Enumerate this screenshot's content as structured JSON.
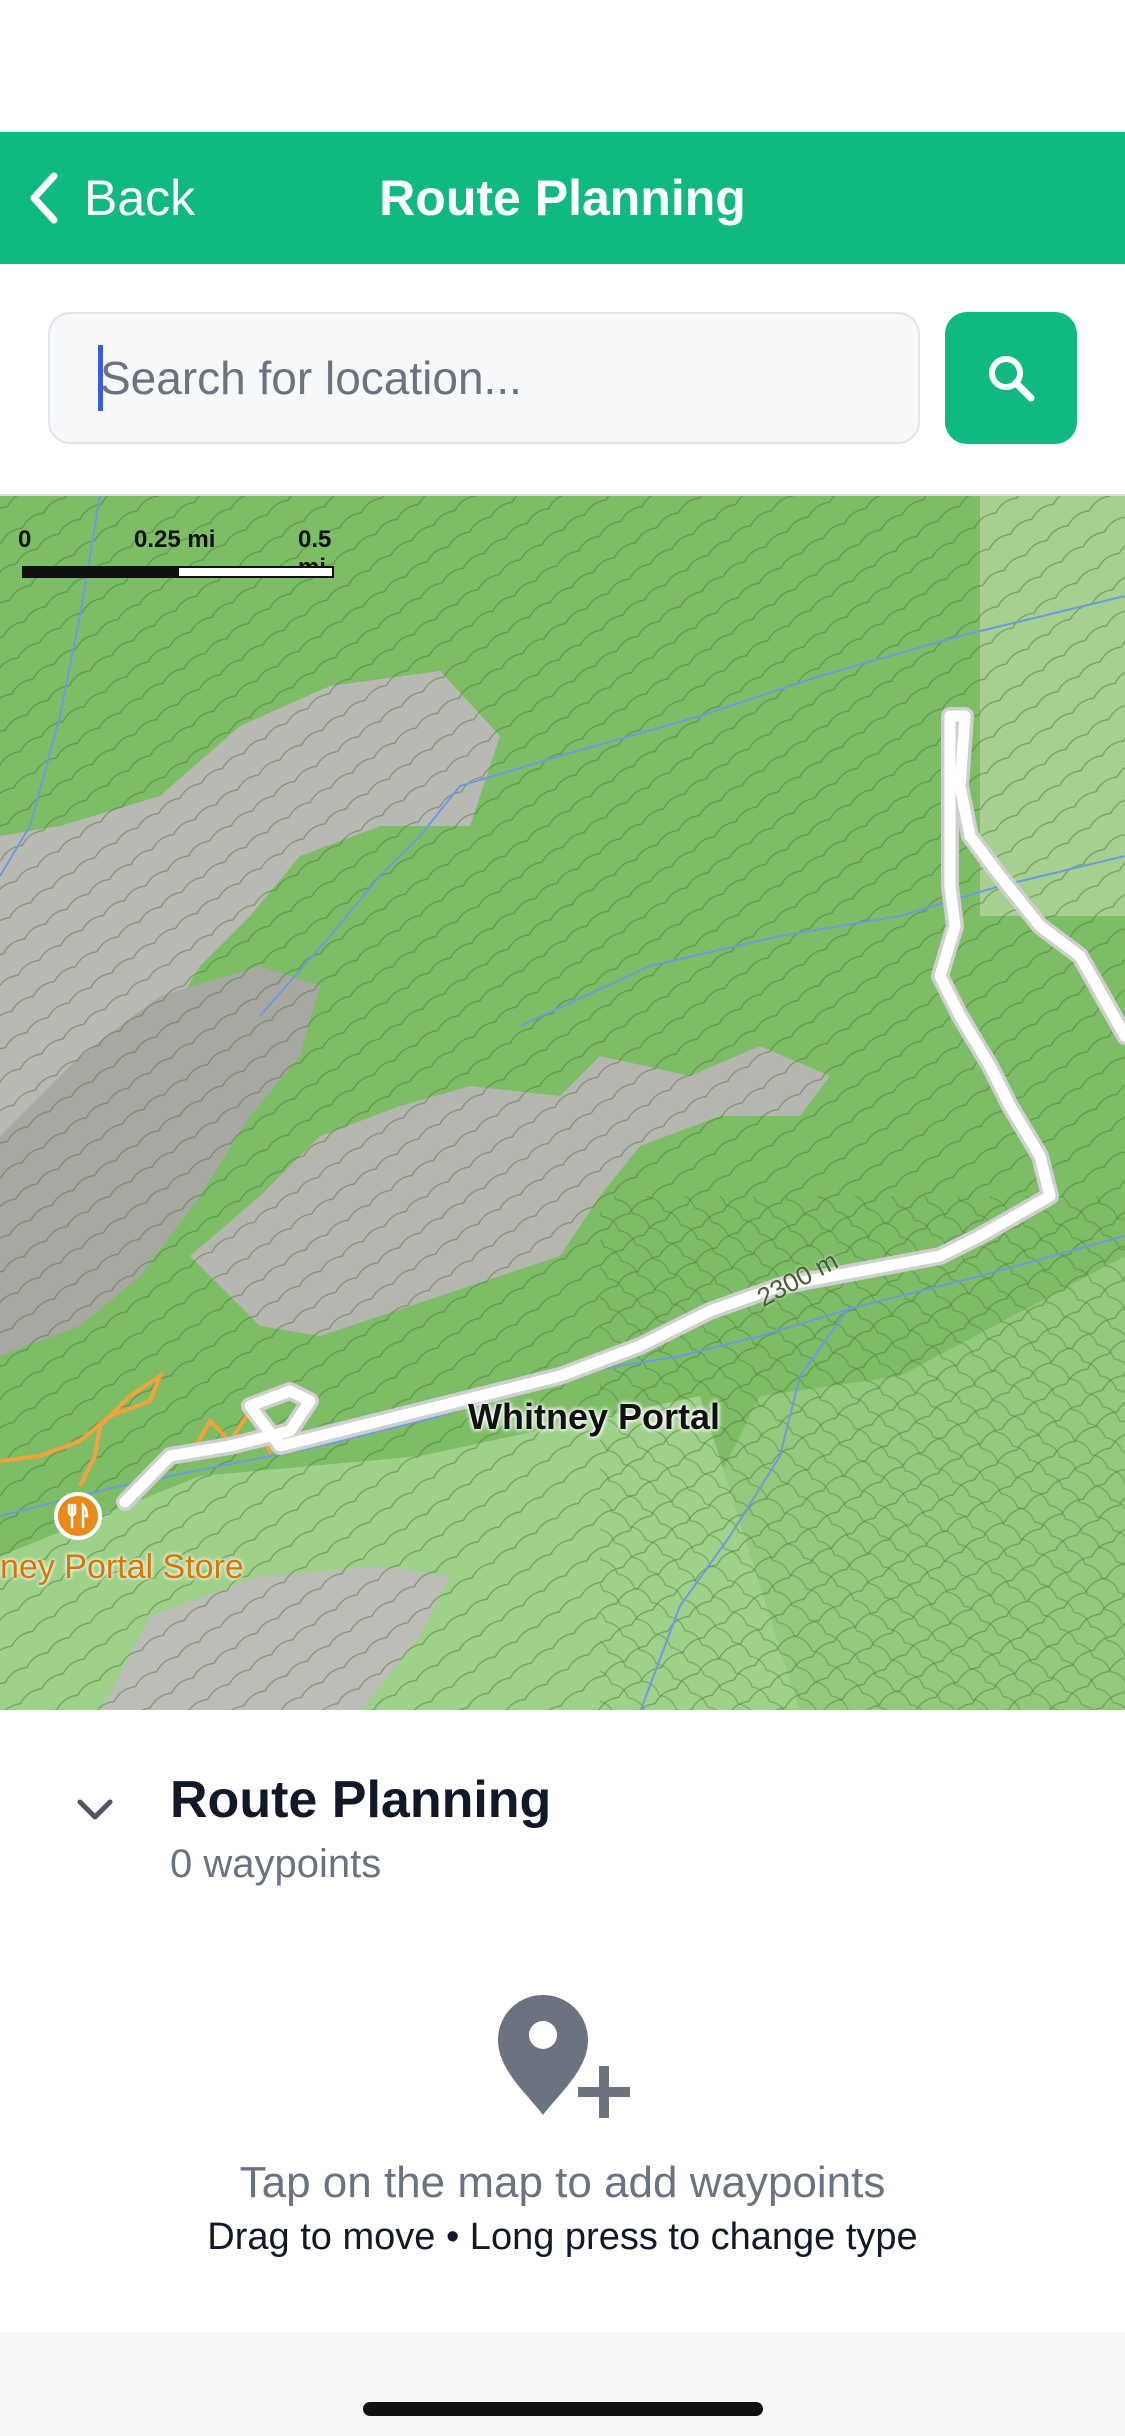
{
  "header": {
    "back_label": "Back",
    "title": "Route Planning",
    "accent_color": "#10b981"
  },
  "search": {
    "placeholder": "Search for location...",
    "value": "",
    "button_icon": "search-icon"
  },
  "map": {
    "scale": {
      "ticks": [
        "0",
        "0.25 mi",
        "0.5 mi"
      ]
    },
    "place_label": "Whitney Portal",
    "elevation_label": "2300 m",
    "poi": {
      "label": "ney Portal Store",
      "icon": "restaurant-icon"
    }
  },
  "panel": {
    "title": "Route Planning",
    "waypoint_count": "0 waypoints",
    "empty_icon": "map-pin-plus-icon",
    "empty_message": "Tap on the map to add waypoints",
    "hint": "Drag to move • Long press to change type"
  }
}
